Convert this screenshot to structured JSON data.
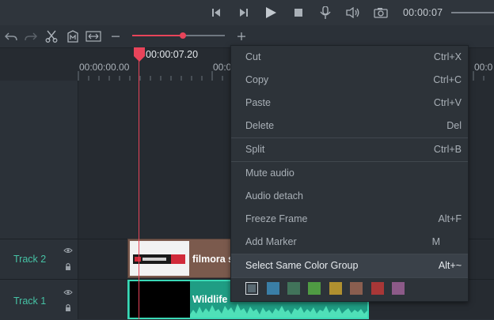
{
  "transport": {
    "icons": [
      "skip-back-icon",
      "step-forward-icon",
      "play-icon",
      "stop-icon",
      "microphone-icon",
      "volume-icon",
      "snapshot-icon"
    ],
    "timecode": "00:00:07"
  },
  "toolbar": {
    "icons": [
      "undo-icon",
      "redo-icon",
      "cut-icon",
      "marker-icon",
      "fit-icon",
      "zoom-out-icon",
      "zoom-in-icon"
    ],
    "zoom_level": 0.55
  },
  "ruler": {
    "labels": [
      "00:00:00.00",
      "00:0",
      "00:0"
    ]
  },
  "playhead": {
    "time": "00:00:07.20"
  },
  "tracks": [
    {
      "name": "Track 2",
      "clip": "filmora s"
    },
    {
      "name": "Track 1",
      "clip": "Wildlife"
    }
  ],
  "menu": {
    "items": [
      {
        "label": "Cut",
        "shortcut": "Ctrl+X"
      },
      {
        "label": "Copy",
        "shortcut": "Ctrl+C"
      },
      {
        "label": "Paste",
        "shortcut": "Ctrl+V"
      },
      {
        "label": "Delete",
        "shortcut": "Del"
      },
      {
        "label": "Split",
        "shortcut": "Ctrl+B"
      },
      {
        "label": "Mute audio",
        "shortcut": ""
      },
      {
        "label": "Audio detach",
        "shortcut": ""
      },
      {
        "label": "Freeze Frame",
        "shortcut": "Alt+F"
      },
      {
        "label": "Add Marker",
        "shortcut": "M"
      },
      {
        "label": "Select Same Color Group",
        "shortcut": "Alt+~"
      }
    ],
    "highlighted": "Select Same Color Group",
    "colors": [
      "#5a6a73",
      "#3a7ea6",
      "#41735a",
      "#4f9b43",
      "#b0902f",
      "#8a5e4f",
      "#a83737",
      "#8c5a88"
    ]
  }
}
